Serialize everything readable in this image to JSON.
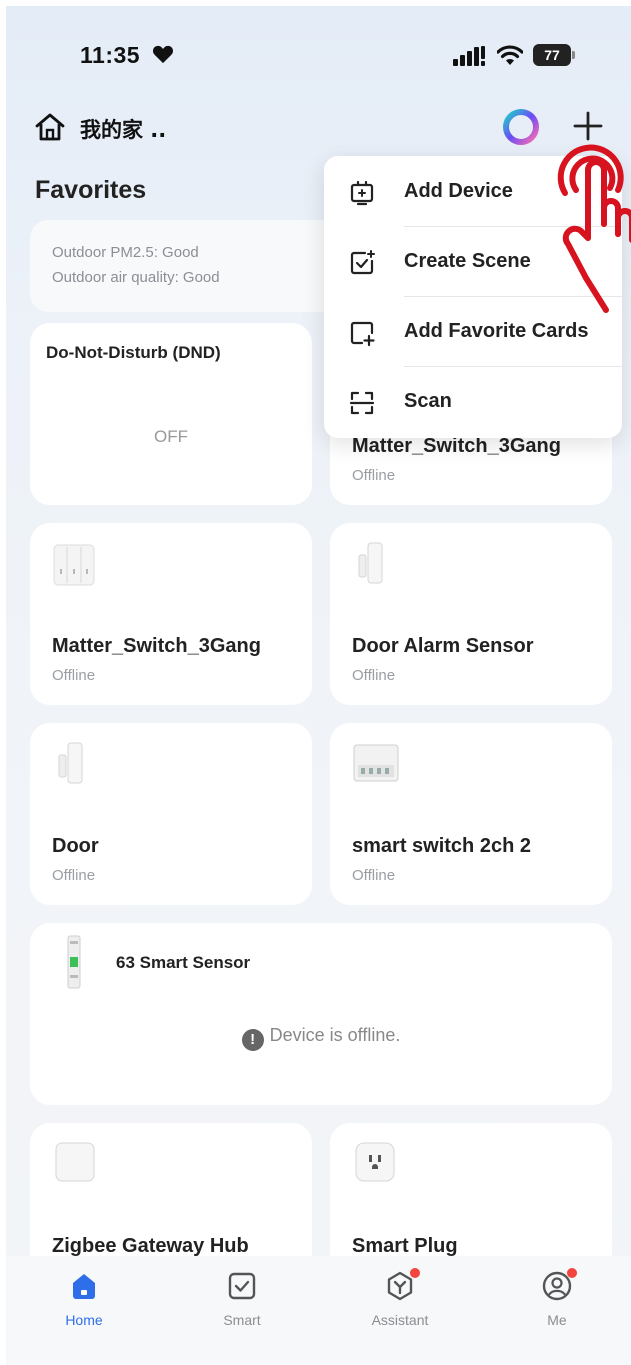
{
  "status_bar": {
    "time": "11:35",
    "battery": "77"
  },
  "header": {
    "home_name": "我的家 .."
  },
  "favorites": {
    "title": "Favorites"
  },
  "weather": {
    "line1": "Outdoor PM2.5: Good",
    "line2": "Outdoor air quality: Good"
  },
  "dnd_card": {
    "title": "Do-Not-Disturb (DND)",
    "value": "OFF"
  },
  "devices": [
    {
      "name": "Matter_Switch_3Gang",
      "status": "Offline"
    },
    {
      "name": "Matter_Switch_3Gang",
      "status": "Offline"
    },
    {
      "name": "Door Alarm Sensor",
      "status": "Offline"
    },
    {
      "name": "Door",
      "status": "Offline"
    },
    {
      "name": "smart switch 2ch 2",
      "status": "Offline"
    },
    {
      "name": "63 Smart Sensor",
      "status": "Device is offline."
    },
    {
      "name": "Zigbee Gateway Hub",
      "status": ""
    },
    {
      "name": "Smart Plug",
      "status": ""
    }
  ],
  "menu": {
    "items": [
      {
        "label": "Add Device",
        "icon": "add-device-icon"
      },
      {
        "label": "Create Scene",
        "icon": "create-scene-icon"
      },
      {
        "label": "Add Favorite Cards",
        "icon": "add-favorite-card-icon"
      },
      {
        "label": "Scan",
        "icon": "scan-icon"
      }
    ]
  },
  "nav": {
    "items": [
      {
        "label": "Home",
        "icon": "home-tab-icon",
        "active": true
      },
      {
        "label": "Smart",
        "icon": "smart-tab-icon"
      },
      {
        "label": "Assistant",
        "icon": "assistant-tab-icon"
      },
      {
        "label": "Me",
        "icon": "me-tab-icon"
      }
    ]
  },
  "colors": {
    "accent": "#2f6ee9",
    "badge": "#f2453d",
    "pointer": "#d7131f"
  }
}
